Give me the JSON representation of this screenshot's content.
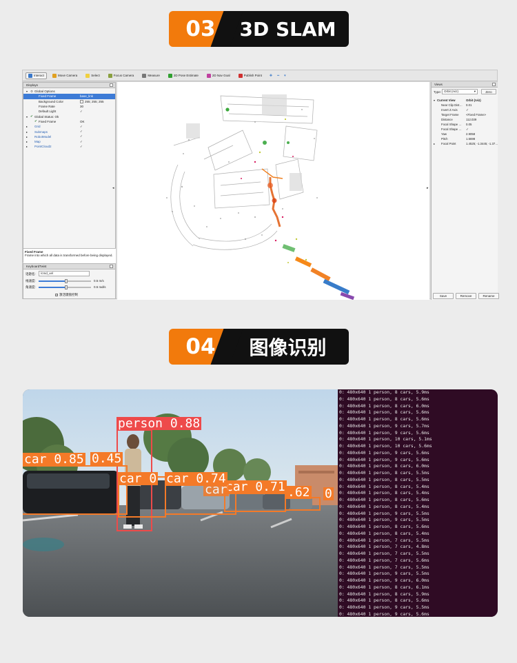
{
  "sections": [
    {
      "num": "03",
      "title": "3D SLAM"
    },
    {
      "num": "04",
      "title": "图像识别"
    }
  ],
  "rviz": {
    "toolbar": [
      {
        "label": "Interact",
        "icon": "interact-icon",
        "color": "#3a78c9",
        "active": true
      },
      {
        "label": "Move Camera",
        "icon": "move-camera-icon",
        "color": "#e0a020"
      },
      {
        "label": "Select",
        "icon": "select-icon",
        "color": "#f0d040"
      },
      {
        "label": "Focus Camera",
        "icon": "focus-camera-icon",
        "color": "#8aa040"
      },
      {
        "label": "Measure",
        "icon": "measure-icon",
        "color": "#777777"
      },
      {
        "label": "2D Pose Estimate",
        "icon": "pose-estimate-icon",
        "color": "#30a030"
      },
      {
        "label": "2D Nav Goal",
        "icon": "nav-goal-icon",
        "color": "#c040a0"
      },
      {
        "label": "Publish Point",
        "icon": "publish-point-icon",
        "color": "#d03030"
      }
    ],
    "displays": {
      "title": "Displays",
      "rows": [
        {
          "name": "Global Options",
          "val": "",
          "indent": 1,
          "arrow": "▾",
          "icon": "gear-icon"
        },
        {
          "name": "Fixed Frame",
          "val": "base_link",
          "indent": 2,
          "selected": true
        },
        {
          "name": "Background Color",
          "val": "255; 255; 255",
          "indent": 2,
          "swatch": true
        },
        {
          "name": "Frame Rate",
          "val": "30",
          "indent": 2
        },
        {
          "name": "Default Light",
          "val": "",
          "indent": 2,
          "check": true
        },
        {
          "name": "Global Status: Ok",
          "val": "",
          "indent": 1,
          "arrow": "▾",
          "icon": "check-icon"
        },
        {
          "name": "Fixed Frame",
          "val": "OK",
          "indent": 2,
          "icon": "check-icon"
        },
        {
          "name": "Grid",
          "val": "",
          "indent": 1,
          "arrow": "▸",
          "blue": true,
          "check": true
        },
        {
          "name": "Submaps",
          "val": "",
          "indent": 1,
          "arrow": "▸",
          "blue": true,
          "check": true
        },
        {
          "name": "RobotModel",
          "val": "",
          "indent": 1,
          "arrow": "▸",
          "blue": true,
          "check": true
        },
        {
          "name": "Map",
          "val": "",
          "indent": 1,
          "arrow": "▸",
          "blue": true,
          "check": true
        },
        {
          "name": "PointCloud2",
          "val": "",
          "indent": 1,
          "arrow": "▸",
          "blue": true,
          "check": true
        }
      ],
      "desc_title": "Fixed Frame",
      "desc_text": "Frame into which all data is transformed before being displayed.",
      "buttons": [
        "Add",
        "Duplicate",
        "Remove",
        "Rename"
      ]
    },
    "keyboard": {
      "title": "KeyboardTwist",
      "topic_label": "话题名:",
      "topic_value": "/cmd_vel",
      "linear_label": "线速度:",
      "linear_value": "0.5 m/s",
      "linear_level": 0.5,
      "angular_label": "角速度:",
      "angular_value": "0.5 rad/s",
      "angular_level": 0.5,
      "enable_label": "激活键盘控制"
    },
    "views": {
      "title": "Views",
      "type_label": "Type:",
      "type_value": "Orbit (rviz)",
      "zero_label": "Zero",
      "rows": [
        {
          "name": "Current View",
          "val": "Orbit (rviz)",
          "header": true
        },
        {
          "name": "Near Clip Dist…",
          "val": "0.01"
        },
        {
          "name": "Invert Z Axis",
          "val": "",
          "check": true
        },
        {
          "name": "Target Frame",
          "val": "<Fixed Frame>"
        },
        {
          "name": "Distance",
          "val": "112.039"
        },
        {
          "name": "Focal Shape …",
          "val": "0.05"
        },
        {
          "name": "Focal Shape …",
          "val": "",
          "check": true
        },
        {
          "name": "Yaw",
          "val": "2.9058"
        },
        {
          "name": "Pitch",
          "val": "1.5698"
        },
        {
          "name": "Focal Point",
          "val": "1.4525; -1.3445; -1.37…",
          "arrow": true
        }
      ],
      "buttons": [
        "Save",
        "Remove",
        "Rename"
      ]
    }
  },
  "detection": {
    "labels": [
      {
        "text": "person 0.88",
        "color": "#ee4a4a"
      },
      {
        "text": "car 0.85",
        "color": "#f47a28"
      },
      {
        "text": "0.45",
        "color": "#f47a28"
      },
      {
        "text": "car 0",
        "color": "#f47a28"
      },
      {
        "text": "car 0.74",
        "color": "#f47a28"
      },
      {
        "text": "car 0.71",
        "color": "#f47a28"
      },
      {
        "text": "car",
        "color": "#f47a28"
      },
      {
        "text": ".62",
        "color": "#f47a28"
      },
      {
        "text": "0",
        "color": "#f47a28"
      }
    ],
    "terminal_lines": [
      "0: 480x640 1 person, 8 cars, 5.9ms",
      "0: 480x640 1 person, 8 cars, 5.6ms",
      "0: 480x640 1 person, 8 cars, 6.0ms",
      "0: 480x640 1 person, 8 cars, 5.6ms",
      "0: 480x640 1 person, 8 cars, 5.6ms",
      "0: 480x640 1 person, 9 cars, 5.7ms",
      "0: 480x640 1 person, 9 cars, 5.6ms",
      "0: 480x640 1 person, 10 cars, 5.1ms",
      "0: 480x640 1 person, 10 cars, 5.6ms",
      "0: 480x640 1 person, 9 cars, 5.6ms",
      "0: 480x640 1 person, 9 cars, 5.6ms",
      "0: 480x640 1 person, 8 cars, 6.0ms",
      "0: 480x640 1 person, 8 cars, 5.5ms",
      "0: 480x640 1 person, 8 cars, 5.5ms",
      "0: 480x640 1 person, 8 cars, 5.4ms",
      "0: 480x640 1 person, 8 cars, 5.4ms",
      "0: 480x640 1 person, 8 cars, 5.6ms",
      "0: 480x640 1 person, 8 cars, 5.4ms",
      "0: 480x640 1 person, 9 cars, 5.5ms",
      "0: 480x640 1 person, 9 cars, 5.5ms",
      "0: 480x640 1 person, 8 cars, 5.6ms",
      "0: 480x640 1 person, 8 cars, 5.4ms",
      "0: 480x640 1 person, 7 cars, 5.5ms",
      "0: 480x640 1 person, 7 cars, 4.8ms",
      "0: 480x640 1 person, 7 cars, 5.5ms",
      "0: 480x640 1 person, 7 cars, 5.6ms",
      "0: 480x640 1 person, 7 cars, 5.5ms",
      "0: 480x640 1 person, 9 cars, 5.5ms",
      "0: 480x640 1 person, 9 cars, 6.0ms",
      "0: 480x640 1 person, 8 cars, 6.1ms",
      "0: 480x640 1 person, 8 cars, 5.9ms",
      "0: 480x640 1 person, 8 cars, 5.6ms",
      "0: 480x640 1 person, 9 cars, 5.5ms",
      "0: 480x640 1 person, 9 cars, 5.6ms",
      "0: 480x640 1 person, 9 cars, 5.4ms",
      "0: 480x640 1 person, 10 cars, 5.4ms",
      "0: 480x640 1 person, 10 cars, 5.5ms",
      "0: 480x640 1 person, 10 cars, 5.5ms",
      "0: 480x640 1 person, 10 cars, 5.8ms",
      "0: 480x640 1 person, 9 cars, 5.4ms"
    ]
  }
}
